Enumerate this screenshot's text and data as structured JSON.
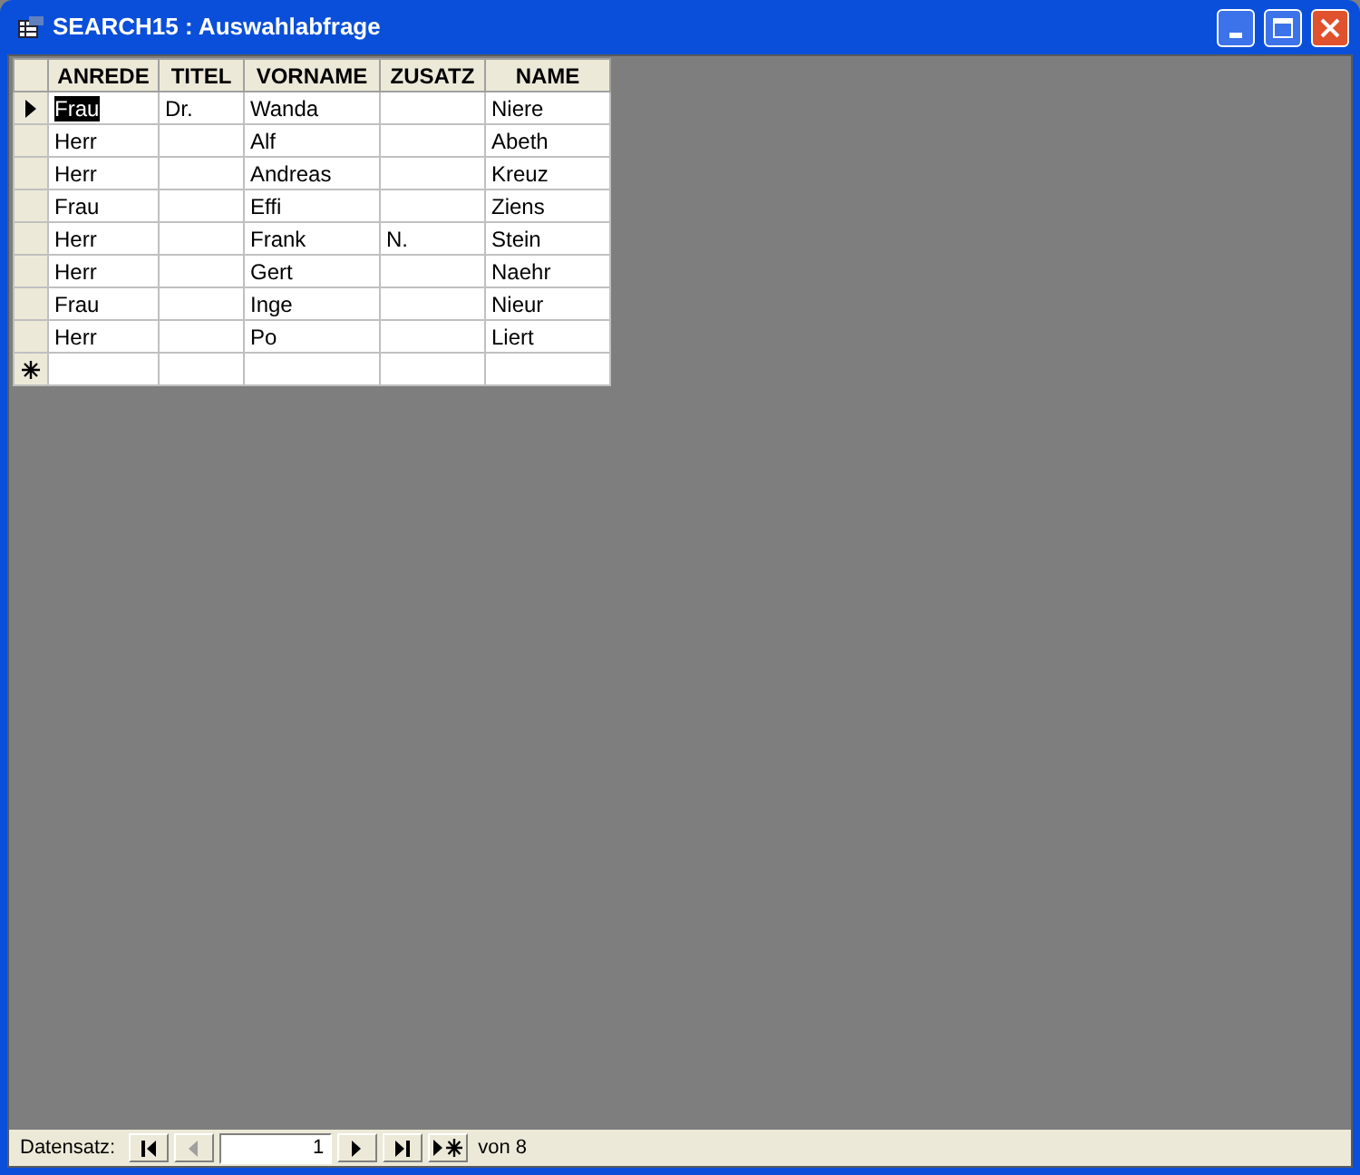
{
  "window": {
    "title": "SEARCH15 : Auswahlabfrage"
  },
  "table": {
    "columns": [
      "ANREDE",
      "TITEL",
      "VORNAME",
      "ZUSATZ",
      "NAME"
    ],
    "rows": [
      {
        "selected": true,
        "cells": [
          "Frau",
          "Dr.",
          "Wanda",
          "",
          "Niere"
        ]
      },
      {
        "selected": false,
        "cells": [
          "Herr",
          "",
          "Alf",
          "",
          "Abeth"
        ]
      },
      {
        "selected": false,
        "cells": [
          "Herr",
          "",
          "Andreas",
          "",
          "Kreuz"
        ]
      },
      {
        "selected": false,
        "cells": [
          "Frau",
          "",
          "Effi",
          "",
          "Ziens"
        ]
      },
      {
        "selected": false,
        "cells": [
          "Herr",
          "",
          "Frank",
          "N.",
          "Stein"
        ]
      },
      {
        "selected": false,
        "cells": [
          "Herr",
          "",
          "Gert",
          "",
          "Naehr"
        ]
      },
      {
        "selected": false,
        "cells": [
          "Frau",
          "",
          "Inge",
          "",
          "Nieur"
        ]
      },
      {
        "selected": false,
        "cells": [
          "Herr",
          "",
          "Po",
          "",
          "Liert"
        ]
      }
    ]
  },
  "navigation": {
    "label": "Datensatz:",
    "record": "1",
    "total": "von 8",
    "buttons": [
      {
        "kind": "first",
        "disabled": false
      },
      {
        "kind": "prev",
        "disabled": true
      },
      {
        "kind": "next",
        "disabled": false
      },
      {
        "kind": "last",
        "disabled": false
      },
      {
        "kind": "new",
        "disabled": false
      }
    ]
  }
}
